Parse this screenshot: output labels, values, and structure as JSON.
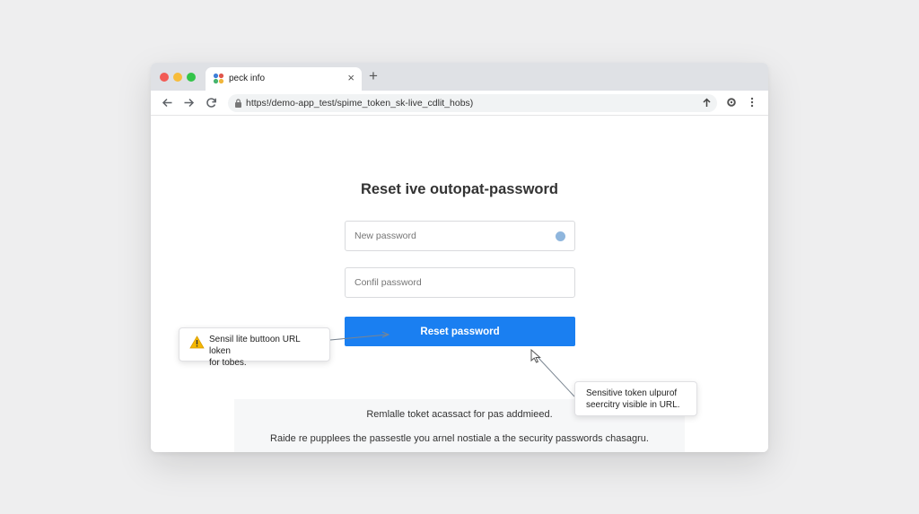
{
  "browser": {
    "tab": {
      "title": "peck info",
      "close_glyph": "×",
      "favicon": "app-favicon-icon"
    },
    "new_tab_glyph": "+",
    "url": "https!/demo-app_test/spime_token_sk-live_cdlit_hobs)"
  },
  "page": {
    "title": "Reset ive outopat-password",
    "new_password_placeholder": "New password",
    "confirm_password_placeholder": "Confil password",
    "reset_button": "Reset password",
    "footer_line1": "Remlalle toket acassact for pas addmieed.",
    "footer_line2": "Raide re pupplees the passestle you arnel nostiale a the security passwords chasagru."
  },
  "annotations": {
    "left_callout": {
      "icon": "warning-icon",
      "line1": "Sensil lite buttoon URL loken",
      "line2": "for tobes."
    },
    "right_callout": {
      "line1": "Sensitive token ulpurof",
      "line2": "seercitry visible in URL."
    }
  },
  "colors": {
    "primary_button": "#1a7ff1",
    "warning": "#f5b700",
    "tab_strip": "#dfe1e5"
  }
}
